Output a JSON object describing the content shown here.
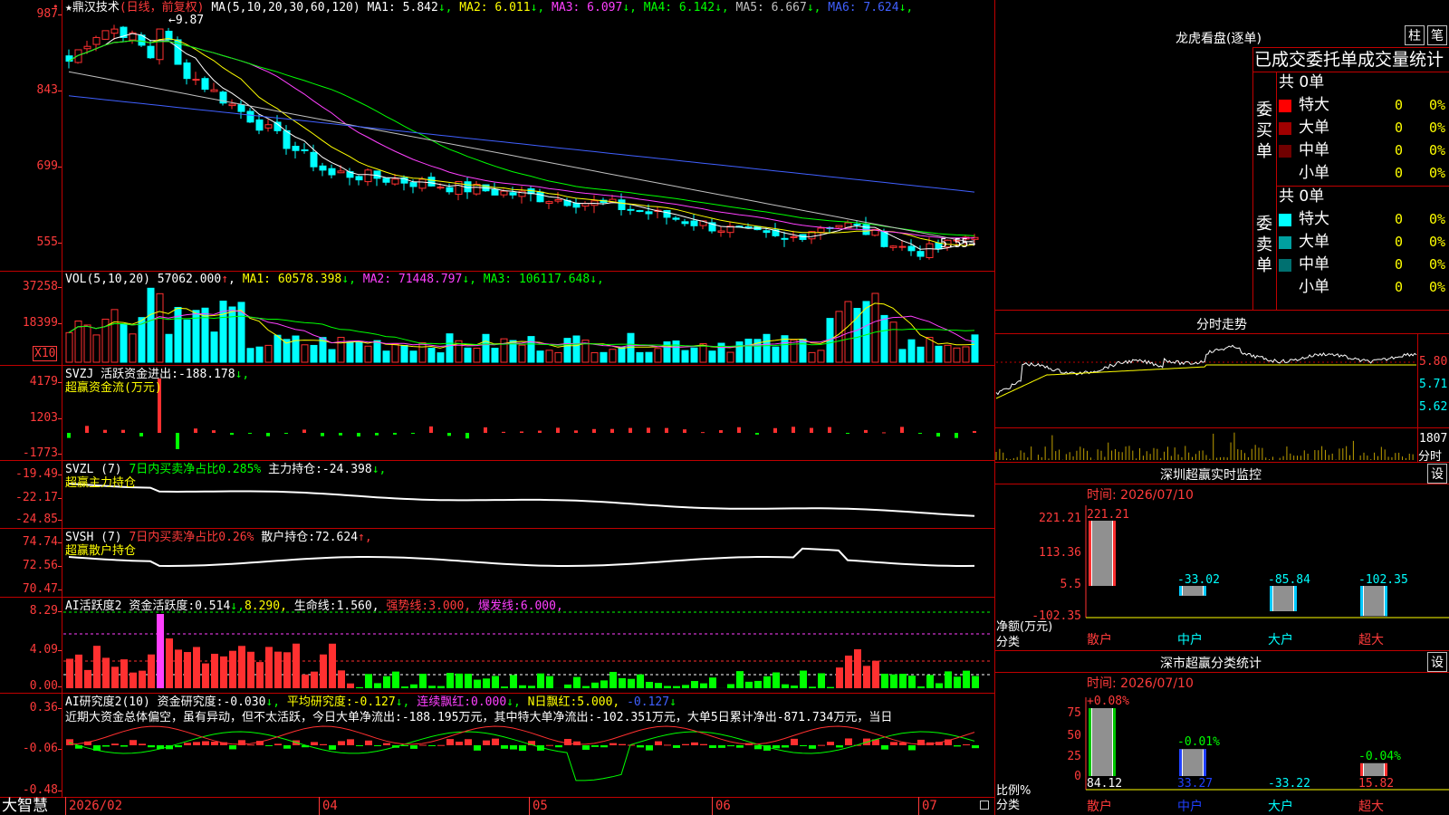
{
  "main_chart": {
    "title": "鼎汉技术",
    "period": "(日线，前复权)",
    "ma_header": "MA(5,10,20,30,60,120)",
    "ma": [
      {
        "label": "MA1:",
        "value": "5.842",
        "arrow": "↓",
        "color": "#ffffff"
      },
      {
        "label": "MA2:",
        "value": "6.011",
        "arrow": "↓",
        "color": "#ffff00"
      },
      {
        "label": "MA3:",
        "value": "6.097",
        "arrow": "↓",
        "color": "#ff40ff"
      },
      {
        "label": "MA4:",
        "value": "6.142",
        "arrow": "↓",
        "color": "#00ff00"
      },
      {
        "label": "MA5:",
        "value": "6.667",
        "arrow": "↓",
        "color": "#c0c0c0"
      },
      {
        "label": "MA6:",
        "value": "7.624",
        "arrow": "↓",
        "color": "#4060ff"
      }
    ],
    "y_labels": [
      "987",
      "843",
      "699",
      "555"
    ],
    "high_label": "9.87",
    "low_label": "5.55"
  },
  "vol_chart": {
    "header": "VOL(5,10,20)",
    "value": "57062.000",
    "ma": [
      {
        "label": "MA1:",
        "value": "60578.398",
        "arrow": "↓",
        "color": "#ffff00"
      },
      {
        "label": "MA2:",
        "value": "71448.797",
        "arrow": "↓",
        "color": "#ff40ff"
      },
      {
        "label": "MA3:",
        "value": "106117.648",
        "arrow": "↓",
        "color": "#00ff00"
      }
    ],
    "y_labels": [
      "37258",
      "18399"
    ],
    "unit_label": "X10"
  },
  "svzj": {
    "header": "SVZJ",
    "line1": "活跃资金进出:",
    "value": "-188.178",
    "arrow": "↓,",
    "line2": "超赢资金流(万元)",
    "y_labels": [
      "4179",
      "1203",
      "-1773"
    ]
  },
  "svzl": {
    "header": "SVZL (7)",
    "desc": "7日内买卖净占比0.285%",
    "label": "主力持仓:",
    "value": "-24.398",
    "arrow": "↓,",
    "line2": "超赢主力持仓",
    "y_labels": [
      "-19.49",
      "-22.17",
      "-24.85"
    ]
  },
  "svsh": {
    "header": "SVSH (7)",
    "desc": "7日内买卖净占比0.26%",
    "label": "散户持仓:",
    "value": "72.624",
    "arrow": "↑,",
    "line2": "超赢散户持仓",
    "y_labels": [
      "74.74",
      "72.56",
      "70.47"
    ]
  },
  "ai_active": {
    "header": "AI活跃度2",
    "label": "资金活跃度:",
    "value": "0.514",
    "v2": "8.290,",
    "lifeline": "生命线:",
    "lifeline_value": "1.560,",
    "strong": "强势线:",
    "strong_value": "3.000,",
    "burst": "爆发线:",
    "burst_value": "6.000,",
    "y_labels": [
      "8.29",
      "4.09",
      "0.00"
    ]
  },
  "ai_research": {
    "header": "AI研究度2(10)",
    "label": "资金研究度:",
    "value": "-0.030",
    "avg_label": "平均研究度:",
    "avg_value": "-0.127",
    "cont_label": "连续飘红:",
    "cont_value": "0.000",
    "n_label": "N日飘红:",
    "n_value": "5.000,",
    "n_value2": "-0.127",
    "comment": "近期大资金总体偏空，虽有异动，但不太活跃，今日大单净流出:-188.195万元，其中特大单净流出:-102.351万元，大单5日累计净出-871.734万元，当日",
    "y_labels": [
      "0.36",
      "-0.06",
      "-0.48"
    ]
  },
  "x_axis": {
    "brand": "大智慧",
    "labels": [
      "2026/02",
      "04",
      "05",
      "06",
      "07"
    ]
  },
  "longhu": {
    "title": "龙虎看盘(逐单)",
    "btn1": "柱",
    "btn2": "笔",
    "header": "已成交委托单成交量统计",
    "buy_label": "委买单",
    "sell_label": "委卖单",
    "buy_total": "共 0单",
    "sell_total": "共 0单",
    "buy_rows": [
      {
        "name": "特大",
        "count": "0",
        "pct": "0%",
        "color": "#ff0000"
      },
      {
        "name": "大单",
        "count": "0",
        "pct": "0%",
        "color": "#a00000"
      },
      {
        "name": "中单",
        "count": "0",
        "pct": "0%",
        "color": "#700000"
      },
      {
        "name": "小单",
        "count": "0",
        "pct": "0%",
        "color": "#000000"
      }
    ],
    "sell_rows": [
      {
        "name": "特大",
        "count": "0",
        "pct": "0%",
        "color": "#00ffff"
      },
      {
        "name": "大单",
        "count": "0",
        "pct": "0%",
        "color": "#00a0a0"
      },
      {
        "name": "中单",
        "count": "0",
        "pct": "0%",
        "color": "#007070"
      },
      {
        "name": "小单",
        "count": "0",
        "pct": "0%",
        "color": "#000000"
      }
    ]
  },
  "intraday": {
    "title": "分时走势",
    "y_labels": [
      "5.80",
      "5.71",
      "5.62"
    ],
    "vol_label": "1807",
    "vol_unit": "分时"
  },
  "sz_monitor": {
    "title": "深圳超赢实时监控",
    "btn": "设",
    "time_label": "时间:",
    "time": "2026/07/10",
    "y_labels": [
      "221.21",
      "113.36",
      "5.5",
      "-102.35"
    ],
    "unit": "净额(万元)",
    "cat_label": "分类",
    "bars": [
      {
        "name": "散户",
        "value": 221.21,
        "label": "221.21"
      },
      {
        "name": "中户",
        "value": -33.02,
        "label": "-33.02"
      },
      {
        "name": "大户",
        "value": -85.84,
        "label": "-85.84"
      },
      {
        "name": "超大",
        "value": -102.35,
        "label": "-102.35"
      }
    ]
  },
  "sz_class": {
    "title": "深市超赢分类统计",
    "btn": "设",
    "time_label": "时间:",
    "time": "2026/07/10",
    "y_labels": [
      "75",
      "50",
      "25",
      "0"
    ],
    "unit": "比例%",
    "cat_label": "分类",
    "bars": [
      {
        "name": "散户",
        "value": 84.12,
        "label": "84.12",
        "top": "+0.08%"
      },
      {
        "name": "中户",
        "value": 33.27,
        "label": "33.27",
        "top": "-0.01%"
      },
      {
        "name": "大户",
        "value": -33.22,
        "label": "-33.22",
        "top": ""
      },
      {
        "name": "超大",
        "value": 15.82,
        "label": "15.82",
        "top": "-0.04%"
      }
    ]
  }
}
